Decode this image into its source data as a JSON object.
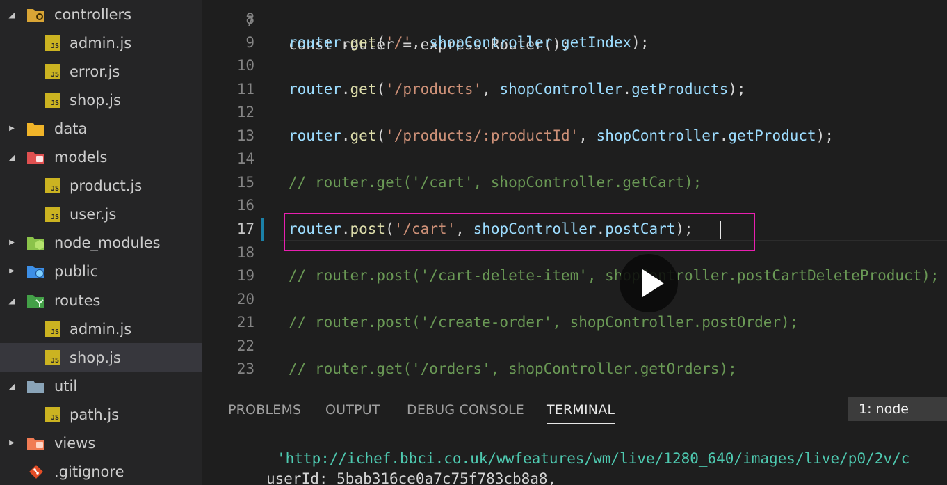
{
  "explorer": {
    "items": [
      {
        "label": "controllers",
        "type": "folder",
        "open": true,
        "icon": "folder-config-icon",
        "color": "#d9a535"
      },
      {
        "label": "admin.js",
        "type": "file",
        "icon": "js-file-icon"
      },
      {
        "label": "error.js",
        "type": "file",
        "icon": "js-file-icon"
      },
      {
        "label": "shop.js",
        "type": "file",
        "icon": "js-file-icon"
      },
      {
        "label": "data",
        "type": "folder",
        "open": false,
        "icon": "folder-icon",
        "color": "#f0b429"
      },
      {
        "label": "models",
        "type": "folder",
        "open": true,
        "icon": "folder-database-icon",
        "color": "#e05050"
      },
      {
        "label": "product.js",
        "type": "file",
        "icon": "js-file-icon"
      },
      {
        "label": "user.js",
        "type": "file",
        "icon": "js-file-icon"
      },
      {
        "label": "node_modules",
        "type": "folder",
        "open": false,
        "icon": "folder-node-icon",
        "color": "#8bc34a"
      },
      {
        "label": "public",
        "type": "folder",
        "open": false,
        "icon": "folder-public-icon",
        "color": "#3d8fe6"
      },
      {
        "label": "routes",
        "type": "folder",
        "open": true,
        "icon": "folder-routes-icon",
        "color": "#43a047"
      },
      {
        "label": "admin.js",
        "type": "file",
        "icon": "js-file-icon"
      },
      {
        "label": "shop.js",
        "type": "file",
        "icon": "js-file-icon",
        "selected": true
      },
      {
        "label": "util",
        "type": "folder",
        "open": true,
        "icon": "folder-icon",
        "color": "#8aa4b8"
      },
      {
        "label": "path.js",
        "type": "file",
        "icon": "js-file-icon"
      },
      {
        "label": "views",
        "type": "folder",
        "open": false,
        "icon": "folder-views-icon",
        "color": "#f07b54"
      },
      {
        "label": ".gitignore",
        "type": "git",
        "icon": "git-icon",
        "color": "#e44d26"
      }
    ],
    "js_badge": "JS"
  },
  "editor": {
    "active_line": 17,
    "top_partial": "const router = express.Router();",
    "lines": [
      {
        "n": "8",
        "tokens": []
      },
      {
        "n": "9",
        "tokens": [
          [
            "router",
            "var"
          ],
          [
            ".",
            "punc"
          ],
          [
            "get",
            "fn"
          ],
          [
            "(",
            "punc"
          ],
          [
            "'/'",
            "str"
          ],
          [
            ", ",
            "punc"
          ],
          [
            "shopController",
            "var"
          ],
          [
            ".",
            "punc"
          ],
          [
            "getIndex",
            "var"
          ],
          [
            ");",
            "punc"
          ]
        ]
      },
      {
        "n": "10",
        "tokens": []
      },
      {
        "n": "11",
        "tokens": [
          [
            "router",
            "var"
          ],
          [
            ".",
            "punc"
          ],
          [
            "get",
            "fn"
          ],
          [
            "(",
            "punc"
          ],
          [
            "'/products'",
            "str"
          ],
          [
            ", ",
            "punc"
          ],
          [
            "shopController",
            "var"
          ],
          [
            ".",
            "punc"
          ],
          [
            "getProducts",
            "var"
          ],
          [
            ");",
            "punc"
          ]
        ]
      },
      {
        "n": "12",
        "tokens": []
      },
      {
        "n": "13",
        "tokens": [
          [
            "router",
            "var"
          ],
          [
            ".",
            "punc"
          ],
          [
            "get",
            "fn"
          ],
          [
            "(",
            "punc"
          ],
          [
            "'/products/:productId'",
            "str"
          ],
          [
            ", ",
            "punc"
          ],
          [
            "shopController",
            "var"
          ],
          [
            ".",
            "punc"
          ],
          [
            "getProduct",
            "var"
          ],
          [
            ");",
            "punc"
          ]
        ]
      },
      {
        "n": "14",
        "tokens": []
      },
      {
        "n": "15",
        "tokens": [
          [
            "// router.get('/cart', shopController.getCart);",
            "cmt"
          ]
        ]
      },
      {
        "n": "16",
        "tokens": []
      },
      {
        "n": "17",
        "tokens": [
          [
            "router",
            "var"
          ],
          [
            ".",
            "punc"
          ],
          [
            "post",
            "fn"
          ],
          [
            "(",
            "punc"
          ],
          [
            "'/cart'",
            "str"
          ],
          [
            ", ",
            "punc"
          ],
          [
            "shopController",
            "var"
          ],
          [
            ".",
            "punc"
          ],
          [
            "postCart",
            "var"
          ],
          [
            ");",
            "punc"
          ]
        ]
      },
      {
        "n": "18",
        "tokens": []
      },
      {
        "n": "19",
        "tokens": [
          [
            "// router.post('/cart-delete-item', shopController.postCartDeleteProduct);",
            "cmt"
          ]
        ]
      },
      {
        "n": "20",
        "tokens": []
      },
      {
        "n": "21",
        "tokens": [
          [
            "// router.post('/create-order', shopController.postOrder);",
            "cmt"
          ]
        ]
      },
      {
        "n": "22",
        "tokens": []
      },
      {
        "n": "23",
        "tokens": [
          [
            "// router.get('/orders', shopController.getOrders);",
            "cmt"
          ]
        ]
      }
    ]
  },
  "panel": {
    "tabs": [
      {
        "label": "PROBLEMS",
        "active": false
      },
      {
        "label": "OUTPUT",
        "active": false
      },
      {
        "label": "DEBUG CONSOLE",
        "active": false
      },
      {
        "label": "TERMINAL",
        "active": true
      }
    ],
    "terminal_select": "1: node",
    "terminal_lines": [
      {
        "text": "'http://ichef.bbci.co.uk/wwfeatures/wm/live/1280_640/images/live/p0/2v/c",
        "color": "#4ec9b0"
      },
      {
        "text": "userId: 5bab316ce0a7c75f783cb8a8,",
        "color": "#d4d4d4"
      }
    ]
  },
  "overlay": {
    "icon": "play-icon"
  }
}
